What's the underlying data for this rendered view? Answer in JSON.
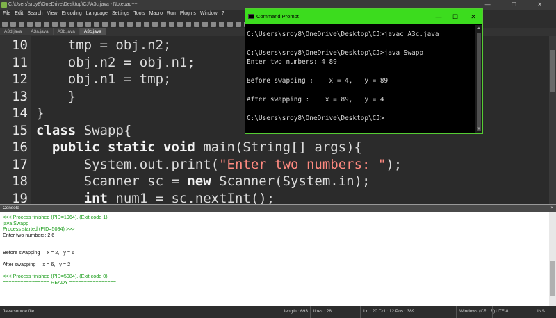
{
  "npp": {
    "title": "C:\\Users\\sroy8\\OneDrive\\Desktop\\CJ\\A3c.java - Notepad++",
    "menu": [
      "File",
      "Edit",
      "Search",
      "View",
      "Encoding",
      "Language",
      "Settings",
      "Tools",
      "Macro",
      "Run",
      "Plugins",
      "Window",
      "?"
    ],
    "tabs": [
      "A3d.java",
      "A3a.java",
      "A3b.java",
      "A3c.java"
    ],
    "active_tab": 3,
    "editor": {
      "lines": [
        {
          "num": "10",
          "code": "    tmp = obj.n2;"
        },
        {
          "num": "11",
          "code": "    obj.n2 = obj.n1;"
        },
        {
          "num": "12",
          "code": "    obj.n1 = tmp;"
        },
        {
          "num": "13",
          "code": "    }"
        },
        {
          "num": "14",
          "code": "}"
        },
        {
          "num": "15",
          "kw": "class",
          "code": " Swapp{"
        },
        {
          "num": "16",
          "kw": "  public static void",
          "code": " main(String[] args){"
        },
        {
          "num": "17",
          "code": "      System.out.print(",
          "str": "\"Enter two numbers: \"",
          "tail": ");"
        },
        {
          "num": "18",
          "code": "      Scanner sc = ",
          "kw2": "new",
          "tail": " Scanner(System.in);"
        },
        {
          "num": "19",
          "kw": "      int",
          "code": " num1 = sc.nextInt();"
        }
      ]
    }
  },
  "console": {
    "title": "Console",
    "close": "×",
    "lines": [
      {
        "text": "<<< Process finished (PID=1964). (Exit code 1)",
        "green": true
      },
      {
        "text": "java Swapp",
        "green": true
      },
      {
        "text": "Process started (PID=5084) >>>",
        "green": true
      },
      {
        "text": "Enter two numbers: 2 6",
        "green": false
      },
      {
        "text": "",
        "green": false
      },
      {
        "text": "",
        "green": false
      },
      {
        "text": "Before swapping :   x = 2,   y = 6",
        "green": false
      },
      {
        "text": "",
        "green": false
      },
      {
        "text": "After swapping :   x = 6,   y = 2",
        "green": false
      },
      {
        "text": "",
        "green": false
      },
      {
        "text": "<<< Process finished (PID=5084). (Exit code 0)",
        "green": true
      },
      {
        "text": "================ READY ================",
        "green": true
      }
    ]
  },
  "statusbar": {
    "filetype": "Java source file",
    "length": "length : 693",
    "lines": "lines : 28",
    "position": "Ln : 20   Col : 12   Pos : 389",
    "eol": "Windows (CR LF)",
    "encoding": "UTF-8",
    "mode": "INS"
  },
  "cmd": {
    "title": "Command Prompt",
    "minimize": "—",
    "maximize": "☐",
    "close": "✕",
    "lines": [
      "C:\\Users\\sroy8\\OneDrive\\Desktop\\CJ>javac A3c.java",
      "",
      "C:\\Users\\sroy8\\OneDrive\\Desktop\\CJ>java Swapp",
      "Enter two numbers: 4 89",
      "",
      "Before swapping :    x = 4,   y = 89",
      "",
      "After swapping :    x = 89,   y = 4",
      "",
      "C:\\Users\\sroy8\\OneDrive\\Desktop\\CJ>"
    ]
  }
}
